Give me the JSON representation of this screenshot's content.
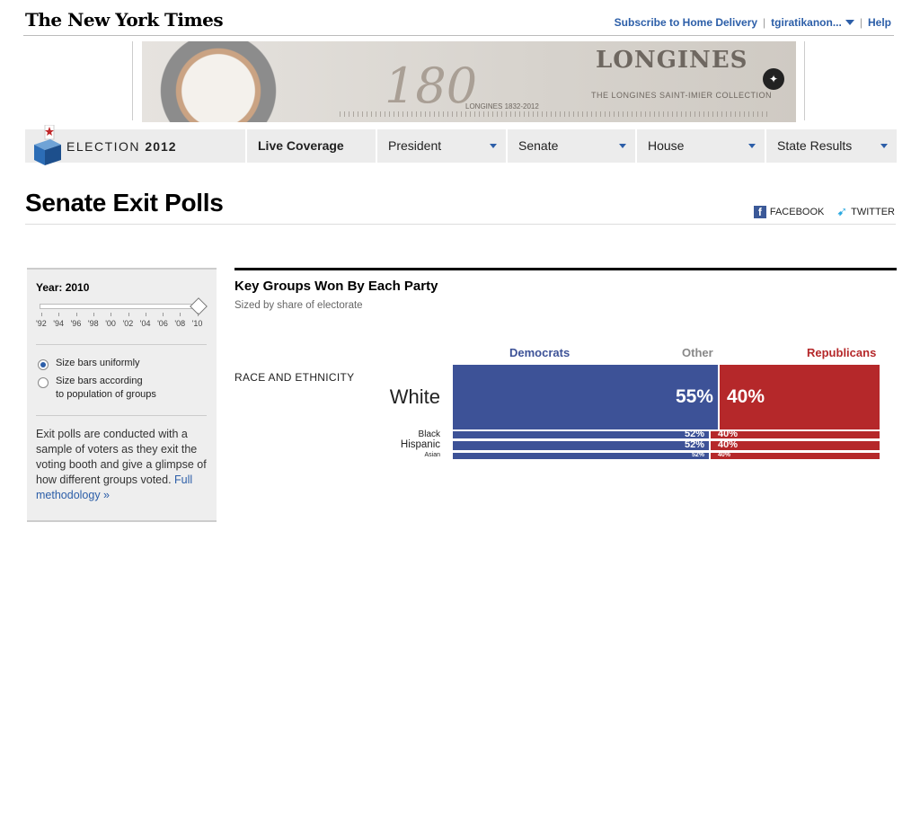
{
  "masthead": {
    "logo": "The New York Times",
    "subscribe": "Subscribe to Home Delivery",
    "user": "tgiratikanon...",
    "help": "Help"
  },
  "ad": {
    "number": "180",
    "brand": "LONGINES",
    "collection": "THE LONGINES SAINT-IMIER COLLECTION",
    "years": "LONGINES 1832-2012"
  },
  "election_nav": {
    "title": "ELECTION",
    "year": "2012",
    "tabs": [
      {
        "label": "Live Coverage",
        "dropdown": false
      },
      {
        "label": "President",
        "dropdown": true
      },
      {
        "label": "Senate",
        "dropdown": true
      },
      {
        "label": "House",
        "dropdown": true
      },
      {
        "label": "State Results",
        "dropdown": true
      }
    ]
  },
  "page": {
    "title": "Senate Exit Polls",
    "share_facebook": "FACEBOOK",
    "share_twitter": "TWITTER"
  },
  "sidebar": {
    "year_label": "Year: 2010",
    "year_ticks": [
      "'92",
      "'94",
      "'96",
      "'98",
      "'00",
      "'02",
      "'04",
      "'06",
      "'08",
      "'10"
    ],
    "selected_year_index": 9,
    "option_uniform": "Size bars uniformly",
    "option_population_line1": "Size bars according",
    "option_population_line2": "to population of groups",
    "selected_option": "uniform",
    "description": "Exit polls are conducted with a sample of voters as they exit the voting booth and give a glimpse of how different groups voted.",
    "methodology_link": "Full methodology »"
  },
  "chart_data": {
    "type": "bar",
    "title": "Key Groups Won By Each Party",
    "subtitle": "Sized by share of electorate",
    "parties": {
      "dem": "Democrats",
      "other": "Other",
      "rep": "Republicans"
    },
    "colors": {
      "dem": "#3d5297",
      "rep": "#b5282a"
    },
    "group_label": "RACE AND ETHNICITY",
    "categories": [
      "White",
      "Black",
      "Hispanic",
      "Asian"
    ],
    "series": [
      {
        "name": "Democrats",
        "labels": [
          "55%",
          "52%",
          "52%",
          "52%"
        ]
      },
      {
        "name": "Republicans",
        "labels": [
          "40%",
          "40%",
          "40%",
          "40%"
        ]
      }
    ]
  }
}
